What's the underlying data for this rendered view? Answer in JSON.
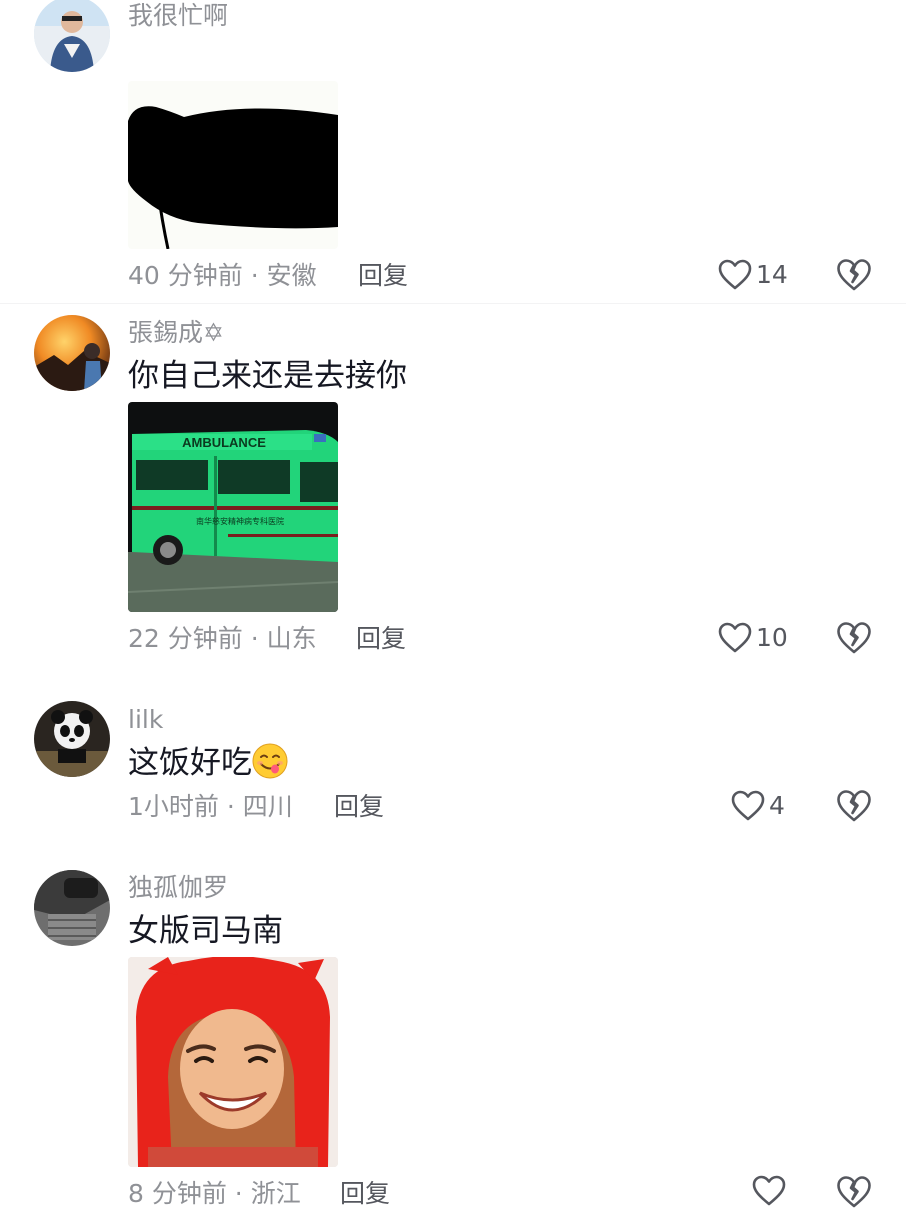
{
  "comments": [
    {
      "username": "我很忙啊",
      "text": "",
      "time": "40 分钟前",
      "location": "安徽",
      "reply_label": "回复",
      "likes": "14",
      "image": "silhouette-bowing-sticker"
    },
    {
      "username": "張錫成✡",
      "text": "你自己来还是去接你",
      "time": "22 分钟前",
      "location": "山东",
      "reply_label": "回复",
      "likes": "10",
      "image": "green-ambulance-photo",
      "image_text": {
        "ambulance": "AMBULANCE",
        "hospital": "南华慈安精神病专科医院"
      }
    },
    {
      "username": "lilk",
      "text": "这饭好吃",
      "emoji": "yum-face-emoji",
      "time": "1小时前",
      "location": "四川",
      "reply_label": "回复",
      "likes": "4"
    },
    {
      "username": "独孤伽罗",
      "text": "女版司马南",
      "time": "8 分钟前",
      "location": "浙江",
      "reply_label": "回复",
      "likes": "",
      "image": "smiling-woman-red-hood-photo"
    }
  ],
  "separator": " · ",
  "icons": {
    "like": "heart-outline-icon",
    "dislike": "broken-heart-icon"
  },
  "colors": {
    "meta": "#8f9196",
    "text": "#161823",
    "ambulance_green": "#22d47a"
  }
}
